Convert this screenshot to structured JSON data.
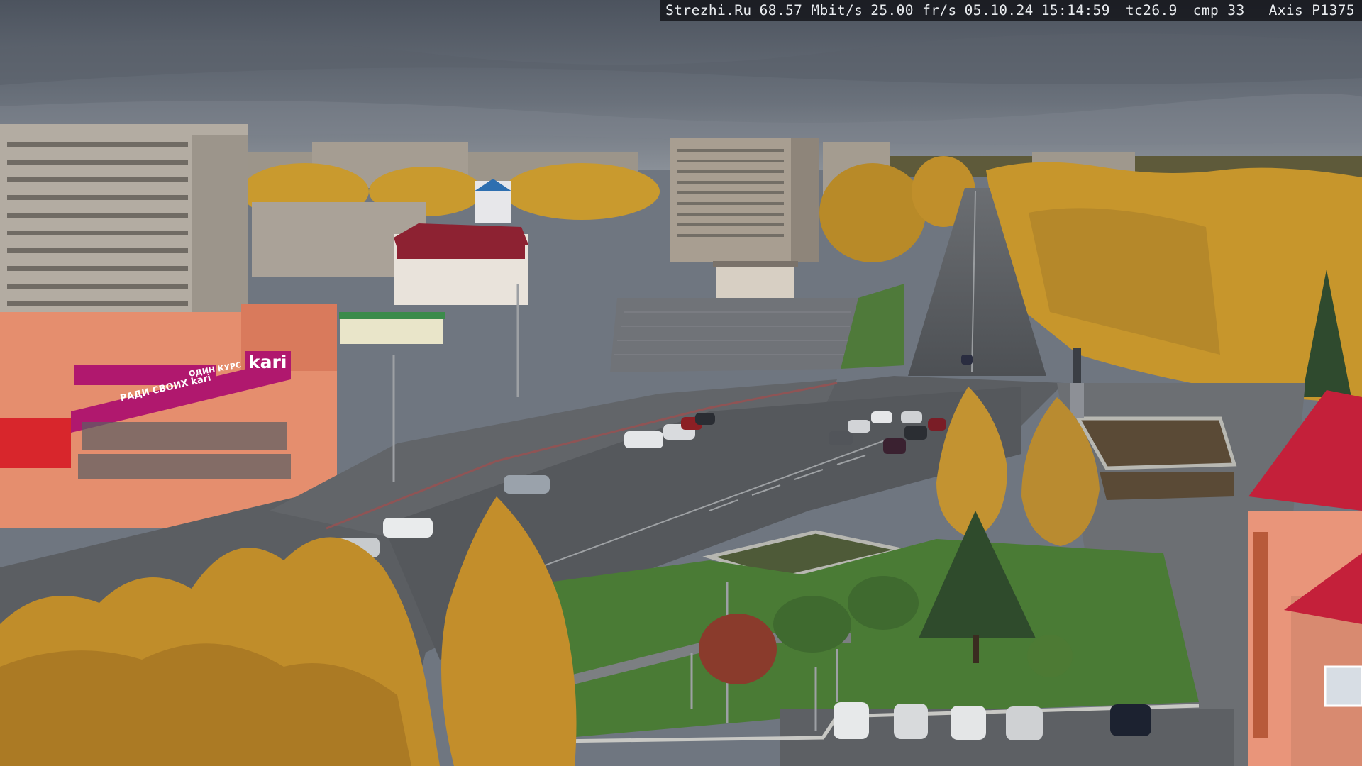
{
  "camera_overlay": {
    "site": "Strezhi.Ru",
    "bitrate": "68.57 Mbit/s",
    "framerate": "25.00 fr/s",
    "date": "05.10.24",
    "time": "15:14:59",
    "tc": "tc26.9",
    "cmp": "cmp 33",
    "camera_model": "Axis P1375"
  },
  "store_signs": {
    "brand": "kari",
    "lower_banner": "РАДИ СВОИХ kari",
    "upper_banner": "ОДИН КУРС"
  },
  "colors": {
    "sky": "#5f6672",
    "autumn_foliage": "#c99a2e",
    "store_accent": "#b0186e",
    "roof_red": "#c4203a",
    "lawn": "#4f7a3a",
    "asphalt": "#56595d"
  }
}
